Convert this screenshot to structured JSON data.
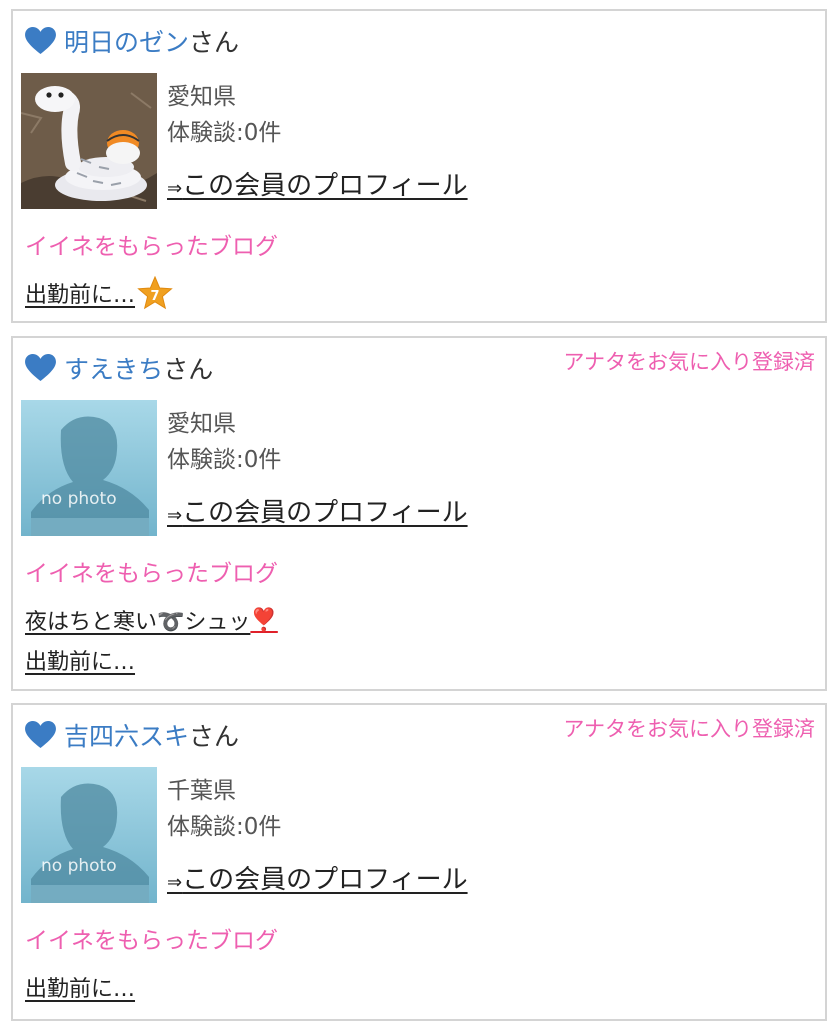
{
  "members": [
    {
      "name": "明日のゼン",
      "honorific": "さん",
      "favorite_badge": "",
      "photo": "snake-plush-photo",
      "prefecture": "愛知県",
      "experience": "体験談:0件",
      "profile_link": {
        "arrow": "⇒",
        "label": "この会員のプロフィール"
      },
      "blog_heading": "イイネをもらったブログ",
      "blogs": [
        {
          "title": "出勤前に…",
          "suffix": "",
          "badge": "star-7-icon",
          "badge_text": "7"
        }
      ]
    },
    {
      "name": "すえきち",
      "honorific": "さん",
      "favorite_badge": "アナタをお気に入り登録済",
      "photo": "no-photo-placeholder",
      "prefecture": "愛知県",
      "experience": "体験談:0件",
      "profile_link": {
        "arrow": "⇒",
        "label": "この会員のプロフィール"
      },
      "blog_heading": "イイネをもらったブログ",
      "blogs": [
        {
          "title": "夜はちと寒い➰シュッ",
          "suffix": "❣️",
          "badge": "",
          "badge_text": ""
        },
        {
          "title": "出勤前に…",
          "suffix": "",
          "badge": "",
          "badge_text": ""
        }
      ]
    },
    {
      "name": "吉四六スキ",
      "honorific": "さん",
      "favorite_badge": "アナタをお気に入り登録済",
      "photo": "no-photo-placeholder",
      "prefecture": "千葉県",
      "experience": "体験談:0件",
      "profile_link": {
        "arrow": "⇒",
        "label": "この会員のプロフィール"
      },
      "blog_heading": "イイネをもらったブログ",
      "blogs": [
        {
          "title": "出勤前に…",
          "suffix": "",
          "badge": "",
          "badge_text": ""
        }
      ]
    }
  ],
  "nophoto_text": "no photo",
  "colors": {
    "name_link": "#3b7cc4",
    "heart": "#3b7cc4",
    "pink": "#ee5fb0",
    "border": "#d4d4d4",
    "star": "#f0a020"
  }
}
